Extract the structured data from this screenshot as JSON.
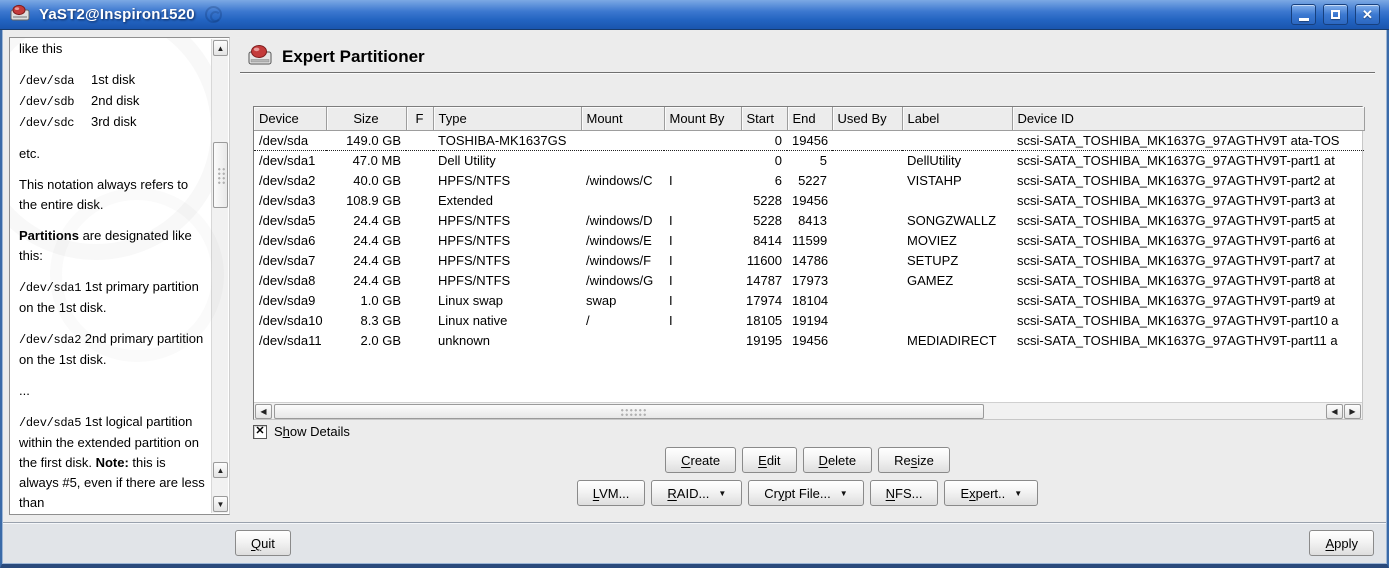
{
  "window": {
    "title": "YaST2@Inspiron1520",
    "titlebar_color": "#2263c0",
    "frame_color": "#2a4a7c"
  },
  "icons": {
    "scroll_up": "▲",
    "scroll_down": "▼",
    "scroll_left": "◀",
    "scroll_right": "▶",
    "dropdown": "▼",
    "close": "✕",
    "checkbox_check": "✕"
  },
  "help_panel": {
    "intro_line": "like this",
    "disks": [
      {
        "dev": "/dev/sda",
        "desc": "1st disk"
      },
      {
        "dev": "/dev/sdb",
        "desc": "2nd disk"
      },
      {
        "dev": "/dev/sdc",
        "desc": "3rd disk"
      }
    ],
    "etc_line": "etc.",
    "notation_line": "This notation always refers to the entire disk.",
    "partitions_bold": "Partitions",
    "partitions_rest": " are designated like this:",
    "primary_examples": [
      {
        "dev": "/dev/sda1",
        "desc": " 1st primary partition on the 1st disk."
      },
      {
        "dev": "/dev/sda2",
        "desc": " 2nd primary partition on the 1st disk."
      }
    ],
    "ellipsis_line": "...",
    "logical_example": {
      "dev": "/dev/sda5",
      "desc": " 1st logical partition within the extended partition on the first disk."
    },
    "note_bold": "Note:",
    "note_rest": " this is always #5, even if there are less than"
  },
  "main": {
    "heading": "Expert Partitioner",
    "table": {
      "columns": [
        "Device",
        "Size",
        "F",
        "Type",
        "Mount",
        "Mount By",
        "Start",
        "End",
        "Used By",
        "Label",
        "Device ID"
      ],
      "selected_row": 0,
      "rows": [
        [
          "/dev/sda",
          "149.0 GB",
          "",
          "TOSHIBA-MK1637GS",
          "",
          "",
          "0",
          "19456",
          "",
          "",
          "scsi-SATA_TOSHIBA_MK1637G_97AGTHV9T ata-TOS"
        ],
        [
          "/dev/sda1",
          "47.0 MB",
          "",
          "Dell Utility",
          "",
          "",
          "0",
          "5",
          "",
          "DellUtility",
          "scsi-SATA_TOSHIBA_MK1637G_97AGTHV9T-part1 at"
        ],
        [
          "/dev/sda2",
          "40.0 GB",
          "",
          "HPFS/NTFS",
          "/windows/C",
          "I",
          "6",
          "5227",
          "",
          "VISTAHP",
          "scsi-SATA_TOSHIBA_MK1637G_97AGTHV9T-part2 at"
        ],
        [
          "/dev/sda3",
          "108.9 GB",
          "",
          "Extended",
          "",
          "",
          "5228",
          "19456",
          "",
          "",
          "scsi-SATA_TOSHIBA_MK1637G_97AGTHV9T-part3 at"
        ],
        [
          "/dev/sda5",
          "24.4 GB",
          "",
          "HPFS/NTFS",
          "/windows/D",
          "I",
          "5228",
          "8413",
          "",
          "SONGZWALLZ",
          "scsi-SATA_TOSHIBA_MK1637G_97AGTHV9T-part5 at"
        ],
        [
          "/dev/sda6",
          "24.4 GB",
          "",
          "HPFS/NTFS",
          "/windows/E",
          "I",
          "8414",
          "11599",
          "",
          "MOVIEZ",
          "scsi-SATA_TOSHIBA_MK1637G_97AGTHV9T-part6 at"
        ],
        [
          "/dev/sda7",
          "24.4 GB",
          "",
          "HPFS/NTFS",
          "/windows/F",
          "I",
          "11600",
          "14786",
          "",
          "SETUPZ",
          "scsi-SATA_TOSHIBA_MK1637G_97AGTHV9T-part7 at"
        ],
        [
          "/dev/sda8",
          "24.4 GB",
          "",
          "HPFS/NTFS",
          "/windows/G",
          "I",
          "14787",
          "17973",
          "",
          "GAMEZ",
          "scsi-SATA_TOSHIBA_MK1637G_97AGTHV9T-part8 at"
        ],
        [
          "/dev/sda9",
          "1.0 GB",
          "",
          "Linux swap",
          "swap",
          "I",
          "17974",
          "18104",
          "",
          "",
          "scsi-SATA_TOSHIBA_MK1637G_97AGTHV9T-part9 at"
        ],
        [
          "/dev/sda10",
          "8.3 GB",
          "",
          "Linux native",
          "/",
          "I",
          "18105",
          "19194",
          "",
          "",
          "scsi-SATA_TOSHIBA_MK1637G_97AGTHV9T-part10 a"
        ],
        [
          "/dev/sda11",
          "2.0 GB",
          "",
          "unknown",
          "",
          "",
          "19195",
          "19456",
          "",
          "MEDIADIRECT",
          "scsi-SATA_TOSHIBA_MK1637G_97AGTHV9T-part11 a"
        ]
      ]
    },
    "show_details": {
      "pre": "S",
      "accel": "h",
      "post": "ow Details",
      "checked": true
    },
    "buttons": {
      "create": {
        "pre": "",
        "accel": "C",
        "post": "reate"
      },
      "edit": {
        "pre": "",
        "accel": "E",
        "post": "dit"
      },
      "delete": {
        "pre": "",
        "accel": "D",
        "post": "elete"
      },
      "resize": {
        "pre": "Re",
        "accel": "s",
        "post": "ize"
      },
      "lvm": {
        "pre": "",
        "accel": "L",
        "post": "VM..."
      },
      "raid": {
        "pre": "",
        "accel": "R",
        "post": "AID..."
      },
      "crypt": {
        "pre": "Cr",
        "accel": "y",
        "post": "pt File..."
      },
      "nfs": {
        "pre": "",
        "accel": "N",
        "post": "FS..."
      },
      "expert": {
        "pre": "E",
        "accel": "x",
        "post": "pert.."
      }
    }
  },
  "footer": {
    "quit": {
      "pre": "",
      "accel": "Q",
      "post": "uit"
    },
    "apply": {
      "pre": "",
      "accel": "A",
      "post": "pply"
    }
  }
}
